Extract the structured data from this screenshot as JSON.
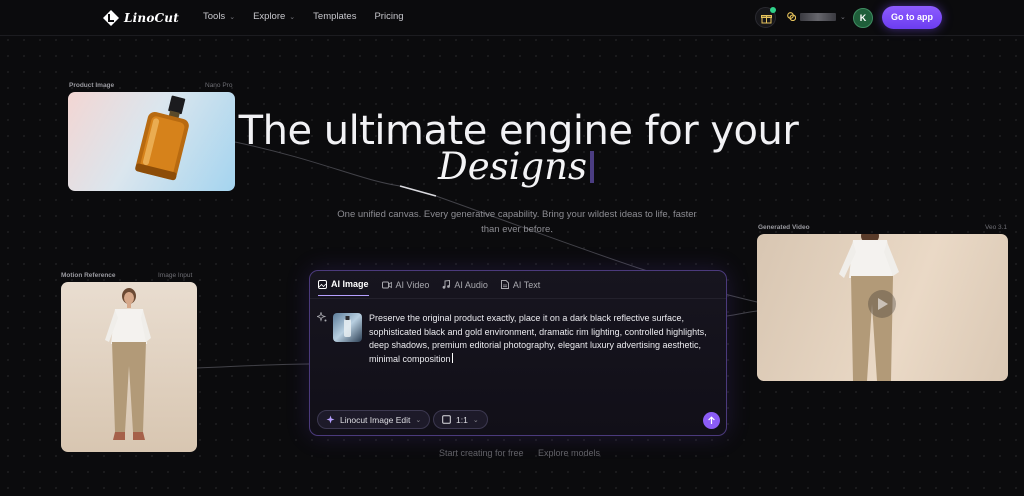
{
  "brand": {
    "name": "LinoCut"
  },
  "nav": {
    "items": [
      {
        "label": "Tools",
        "dropdown": true
      },
      {
        "label": "Explore",
        "dropdown": true
      },
      {
        "label": "Templates",
        "dropdown": false
      },
      {
        "label": "Pricing",
        "dropdown": false
      }
    ],
    "avatar_initial": "K",
    "cta": "Go to app"
  },
  "cards": {
    "product": {
      "label": "Product Image",
      "tag": "Nano Pro"
    },
    "motion": {
      "label": "Motion Reference",
      "tag": "Image Input"
    },
    "video": {
      "label": "Generated Video",
      "tag": "Veo 3.1"
    }
  },
  "hero": {
    "line1": "The ultimate engine for your",
    "line2": "Designs",
    "subtitle": "One unified canvas. Every generative capability. Bring your wildest ideas to life, faster than ever before."
  },
  "composer": {
    "tabs": [
      {
        "label": "AI Image",
        "icon": "image-icon",
        "active": true
      },
      {
        "label": "AI Video",
        "icon": "video-icon",
        "active": false
      },
      {
        "label": "AI Audio",
        "icon": "music-icon",
        "active": false
      },
      {
        "label": "AI Text",
        "icon": "document-icon",
        "active": false
      }
    ],
    "prompt": "Preserve the original product exactly, place it on a dark black reflective surface, sophisticated black and gold environment, dramatic rim lighting, controlled highlights, deep shadows, premium editorial photography, elegant luxury advertising aesthetic, minimal composition",
    "model": "Linocut Image Edit",
    "ratio": "1:1"
  },
  "footer_links": [
    "Start creating for free",
    "Explore models"
  ],
  "colors": {
    "accent": "#8b5cf6",
    "background": "#0b0b0d",
    "status_dot": "#2fd18a"
  }
}
